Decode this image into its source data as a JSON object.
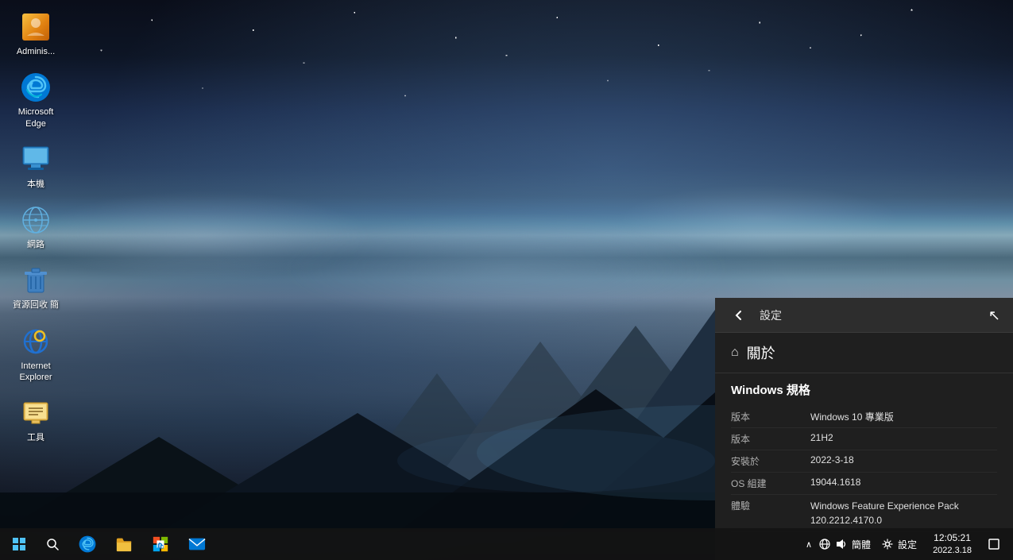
{
  "desktop": {
    "background_desc": "Windows 10 desktop with night sky and mountains wallpaper"
  },
  "icons": [
    {
      "id": "administrator",
      "label": "Adminis...",
      "type": "admin"
    },
    {
      "id": "edge",
      "label": "Microsoft\nEdge",
      "type": "edge"
    },
    {
      "id": "thispc",
      "label": "本機",
      "type": "thispc"
    },
    {
      "id": "network",
      "label": "網路",
      "type": "network"
    },
    {
      "id": "recyclebin",
      "label": "資源回收\n簡",
      "type": "recycle"
    },
    {
      "id": "ie",
      "label": "Internet\nExplorer",
      "type": "ie"
    },
    {
      "id": "tools",
      "label": "工具",
      "type": "tools"
    }
  ],
  "settings_panel": {
    "header": {
      "title": "設定",
      "back_button": "←"
    },
    "about_title": "關於",
    "windows_specs_title": "Windows 規格",
    "specs": [
      {
        "label": "版本",
        "value": "Windows 10 專業版"
      },
      {
        "label": "版本",
        "value": "21H2"
      },
      {
        "label": "安裝於",
        "value": "2022-3-18"
      },
      {
        "label": "OS 組建",
        "value": "19044.1618"
      },
      {
        "label": "體驗",
        "value": "Windows Feature Experience Pack\n120.2212.4170.0"
      }
    ]
  },
  "taskbar": {
    "start_label": "Start",
    "search_label": "Search",
    "apps": [
      {
        "id": "edge",
        "label": "Microsoft Edge"
      },
      {
        "id": "fileexplorer",
        "label": "File Explorer"
      },
      {
        "id": "store",
        "label": "Microsoft Store"
      },
      {
        "id": "mail",
        "label": "Mail"
      }
    ],
    "settings_label": "設定",
    "systray": {
      "chevron": "^",
      "network": "🌐",
      "sound": "🔊",
      "language": "簡體"
    },
    "clock": {
      "time": "12:05:21",
      "date": "2022.3.18"
    },
    "notification": "🔲"
  }
}
